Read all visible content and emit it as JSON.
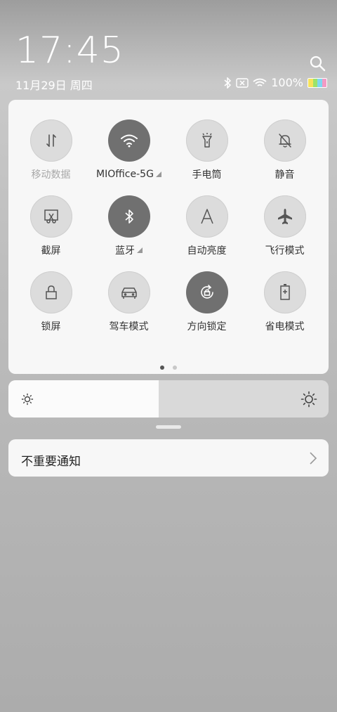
{
  "status": {
    "time": "17:45",
    "date": "11月29日 周四",
    "battery": "100%"
  },
  "tiles": [
    {
      "label": "移动数据",
      "icon": "mobile-data-icon",
      "on": false
    },
    {
      "label": "MIOffice-5G",
      "icon": "wifi-icon",
      "on": true
    },
    {
      "label": "手电筒",
      "icon": "flashlight-icon",
      "on": false
    },
    {
      "label": "静音",
      "icon": "mute-bell-icon",
      "on": false
    },
    {
      "label": "截屏",
      "icon": "screenshot-icon",
      "on": false
    },
    {
      "label": "蓝牙",
      "icon": "bluetooth-icon",
      "on": true
    },
    {
      "label": "自动亮度",
      "icon": "auto-brightness-icon",
      "on": false
    },
    {
      "label": "飞行模式",
      "icon": "airplane-icon",
      "on": false
    },
    {
      "label": "锁屏",
      "icon": "lock-icon",
      "on": false
    },
    {
      "label": "驾车模式",
      "icon": "car-icon",
      "on": false
    },
    {
      "label": "方向锁定",
      "icon": "rotation-lock-icon",
      "on": true
    },
    {
      "label": "省电模式",
      "icon": "battery-saver-icon",
      "on": false
    }
  ],
  "pager": {
    "pages": 2,
    "current": 1
  },
  "brightness": {
    "level": 0.47
  },
  "notification": {
    "label": "不重要通知"
  },
  "colors": {
    "tile_on": "#707070",
    "tile_off": "#dcdcdc",
    "panel": "#f7f7f7"
  }
}
